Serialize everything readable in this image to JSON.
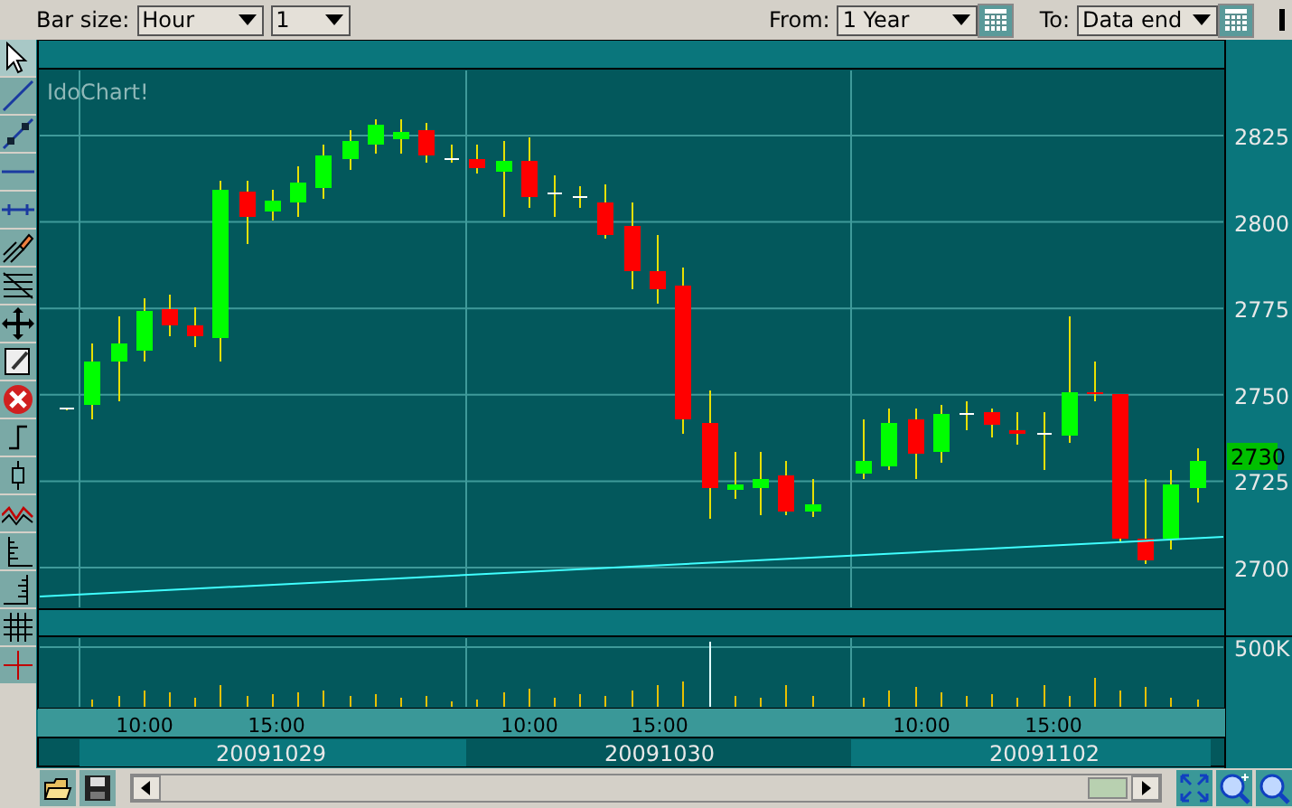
{
  "toolbar": {
    "bar_size_label": "Bar size:",
    "bar_size": "Hour",
    "bar_multiplier": "1",
    "from_label": "From:",
    "from": "1 Year",
    "to_label": "To:",
    "to": "Data end"
  },
  "chart": {
    "logo": "IdoChart!",
    "price_ticks": [
      "2825",
      "2800",
      "2775",
      "2750",
      "2725",
      "2700"
    ],
    "last_price": "2730",
    "volume_tick": "500K",
    "time_labels": [
      "10:00",
      "15:00",
      "10:00",
      "15:00",
      "10:00",
      "15:00"
    ],
    "dates": [
      "20091029",
      "20091030",
      "20091102"
    ]
  }
}
